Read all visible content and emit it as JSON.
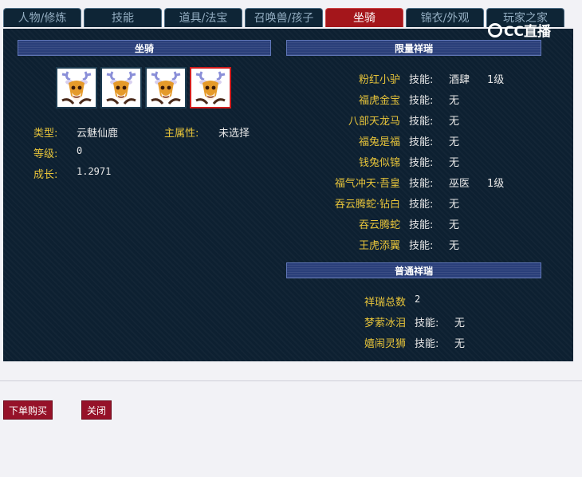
{
  "tabs": [
    {
      "label": "人物/修炼",
      "active": false
    },
    {
      "label": "技能",
      "active": false
    },
    {
      "label": "道具/法宝",
      "active": false
    },
    {
      "label": "召唤兽/孩子",
      "active": false
    },
    {
      "label": "坐骑",
      "active": true
    },
    {
      "label": "锦衣/外观",
      "active": false
    },
    {
      "label": "玩家之家",
      "active": false
    }
  ],
  "watermark": {
    "text": "CC直播"
  },
  "mount_section": {
    "header": "坐骑",
    "icon": "deer-mount-icon",
    "mount_count": 4,
    "selected_index": 3,
    "type_label": "类型:",
    "type_value": "云魅仙鹿",
    "main_attr_label": "主属性:",
    "main_attr_value": "未选择",
    "level_label": "等级:",
    "level_value": "0",
    "growth_label": "成长:",
    "growth_value": "1.2971"
  },
  "limited_section": {
    "header": "限量祥瑞",
    "items": [
      {
        "name": "粉红小驴",
        "skill_label": "技能:",
        "skill": "酒肆",
        "level": "1级"
      },
      {
        "name": "福虎金宝",
        "skill_label": "技能:",
        "skill": "无",
        "level": ""
      },
      {
        "name": "八部天龙马",
        "skill_label": "技能:",
        "skill": "无",
        "level": ""
      },
      {
        "name": "福兔是福",
        "skill_label": "技能:",
        "skill": "无",
        "level": ""
      },
      {
        "name": "钱兔似锦",
        "skill_label": "技能:",
        "skill": "无",
        "level": ""
      },
      {
        "name": "福气冲天·吾皇",
        "skill_label": "技能:",
        "skill": "巫医",
        "level": "1级"
      },
      {
        "name": "吞云腾蛇·钻白",
        "skill_label": "技能:",
        "skill": "无",
        "level": ""
      },
      {
        "name": "吞云腾蛇",
        "skill_label": "技能:",
        "skill": "无",
        "level": ""
      },
      {
        "name": "王虎添翼",
        "skill_label": "技能:",
        "skill": "无",
        "level": ""
      }
    ]
  },
  "normal_section": {
    "header": "普通祥瑞",
    "total_label": "祥瑞总数",
    "total_value": "2",
    "items": [
      {
        "name": "梦萦冰泪",
        "skill_label": "技能:",
        "skill": "无"
      },
      {
        "name": "嬉闹灵狮",
        "skill_label": "技能:",
        "skill": "无"
      }
    ]
  },
  "buttons": {
    "buy": "下单购买",
    "close": "关闭"
  },
  "colors": {
    "panel_bg": "#0d2031",
    "label_gold": "#e7c43a",
    "active_tab": "#a4161b",
    "header_blue": "#2a3f7a",
    "button_red": "#961229"
  }
}
